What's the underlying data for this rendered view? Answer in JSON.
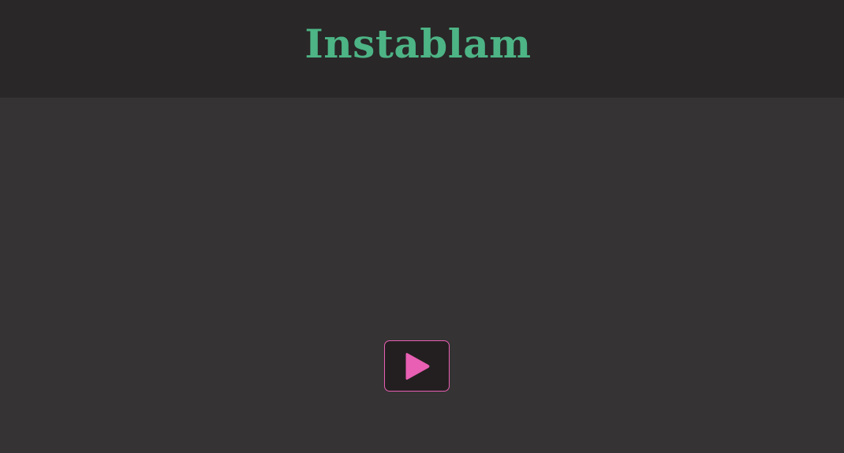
{
  "header": {
    "title": "Instablam"
  },
  "colors": {
    "title": "#4db485",
    "accent": "#e85fb3"
  },
  "player": {
    "play_icon": "play-icon"
  }
}
